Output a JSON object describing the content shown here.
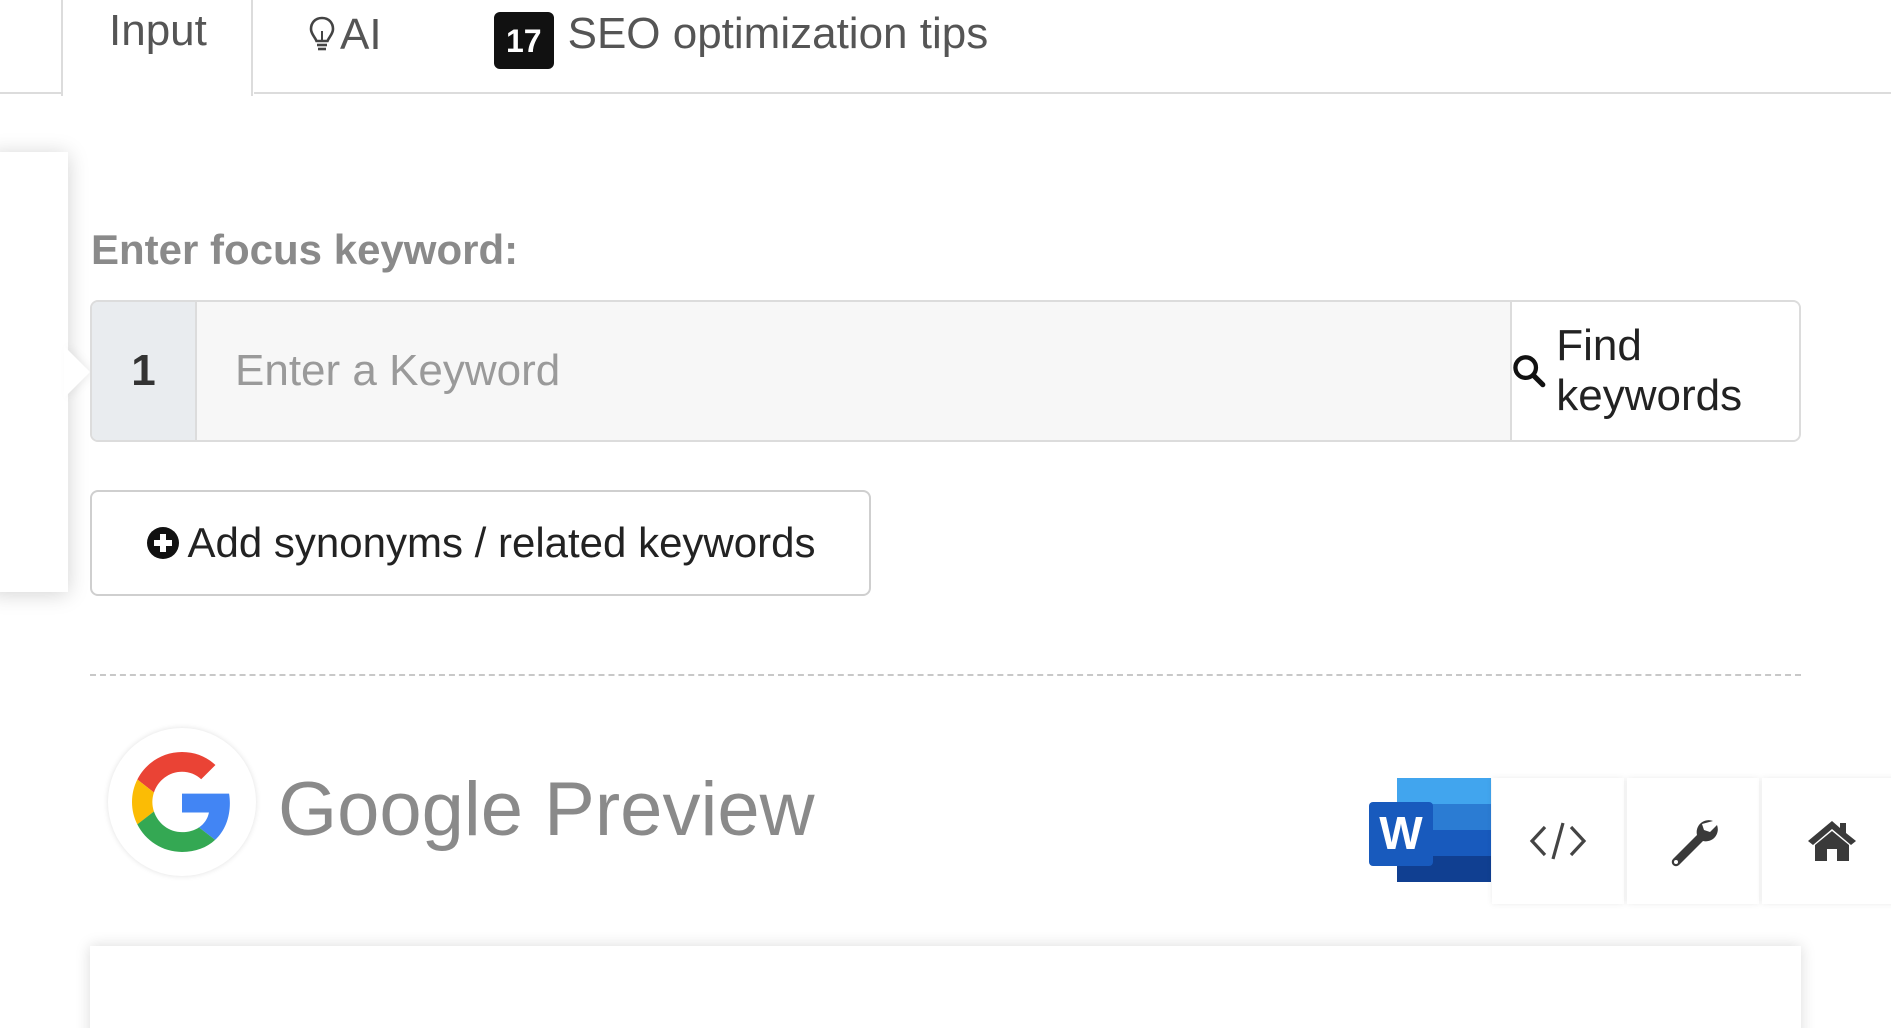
{
  "tabs": [
    {
      "label": "Input"
    },
    {
      "label": "AI"
    },
    {
      "label": "SEO optimization tips",
      "badge": "17"
    }
  ],
  "focus": {
    "label": "Enter focus keyword:",
    "row_number": "1",
    "placeholder": "Enter a Keyword",
    "value": "",
    "find_button": "Find keywords",
    "add_synonyms_button": "Add synonyms / related keywords"
  },
  "preview": {
    "title": "Google Preview"
  },
  "icons": {
    "search": "search-icon",
    "plus": "plus-circle-icon",
    "lightbulb": "lightbulb-icon",
    "google": "google-logo",
    "word": "microsoft-word-icon",
    "code": "code-icon",
    "wrench": "wrench-icon",
    "home": "home-icon"
  },
  "colors": {
    "badge_bg": "#111111",
    "label_gray": "#8a8a8a",
    "word_blue": "#185abd"
  }
}
